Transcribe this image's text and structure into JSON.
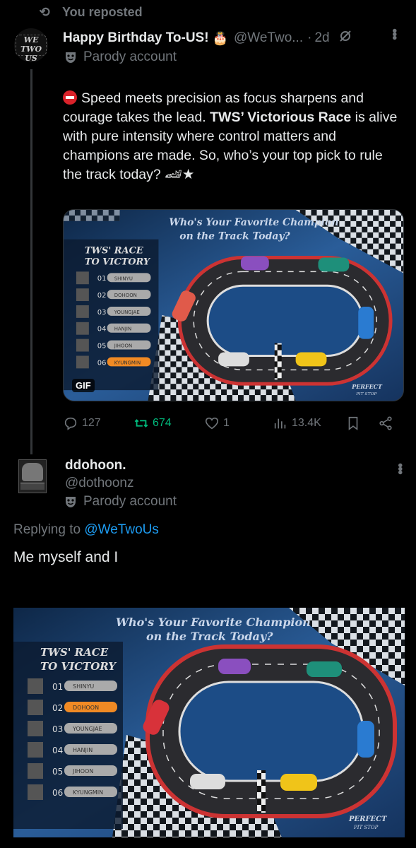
{
  "repost": {
    "label": "You reposted"
  },
  "post": {
    "author_name": "Happy Birthday To-US!",
    "author_emoji": "🎂",
    "author_handle": "@WeTwo...",
    "separator": "·",
    "time": "2d",
    "parody_label": "Parody account",
    "avatar_text": "WE TWO US",
    "text_segments": [
      "Speed meets precision as focus sharpens and courage takes the lead. ",
      "TWS’ Victorious Race",
      " is alive with pure intensity where control matters and champions are made. So, who’s your top pick to rule the track today? ",
      "🏎★"
    ],
    "media": {
      "gif_badge": "GIF",
      "title_line1": "Who's Your Favorite Champion",
      "title_line2": "on the Track Today?",
      "panel_line1": "TWS' RACE",
      "panel_line2": "TO VICTORY",
      "brand_line1": "PERFECT",
      "brand_line2": "PIT STOP",
      "rows": [
        {
          "num": "01",
          "name": "SHINYU"
        },
        {
          "num": "02",
          "name": "DOHOON"
        },
        {
          "num": "03",
          "name": "YOUNGJAE"
        },
        {
          "num": "04",
          "name": "HANJIN"
        },
        {
          "num": "05",
          "name": "JIHOON"
        },
        {
          "num": "06",
          "name": "KYUNGMIN"
        }
      ]
    },
    "stats": {
      "replies": "127",
      "reposts": "674",
      "likes": "1",
      "views": "13.4K"
    },
    "colors": {
      "repost_green": "#00ba7c",
      "link_blue": "#1d9bf0",
      "muted": "#71767b"
    }
  },
  "reply": {
    "author_name": "ddohoon.",
    "author_handle": "@dothoonz",
    "parody_label": "Parody account",
    "replying_prefix": "Replying to ",
    "replying_handle": "@WeTwoUs",
    "text": "Me myself and I"
  }
}
